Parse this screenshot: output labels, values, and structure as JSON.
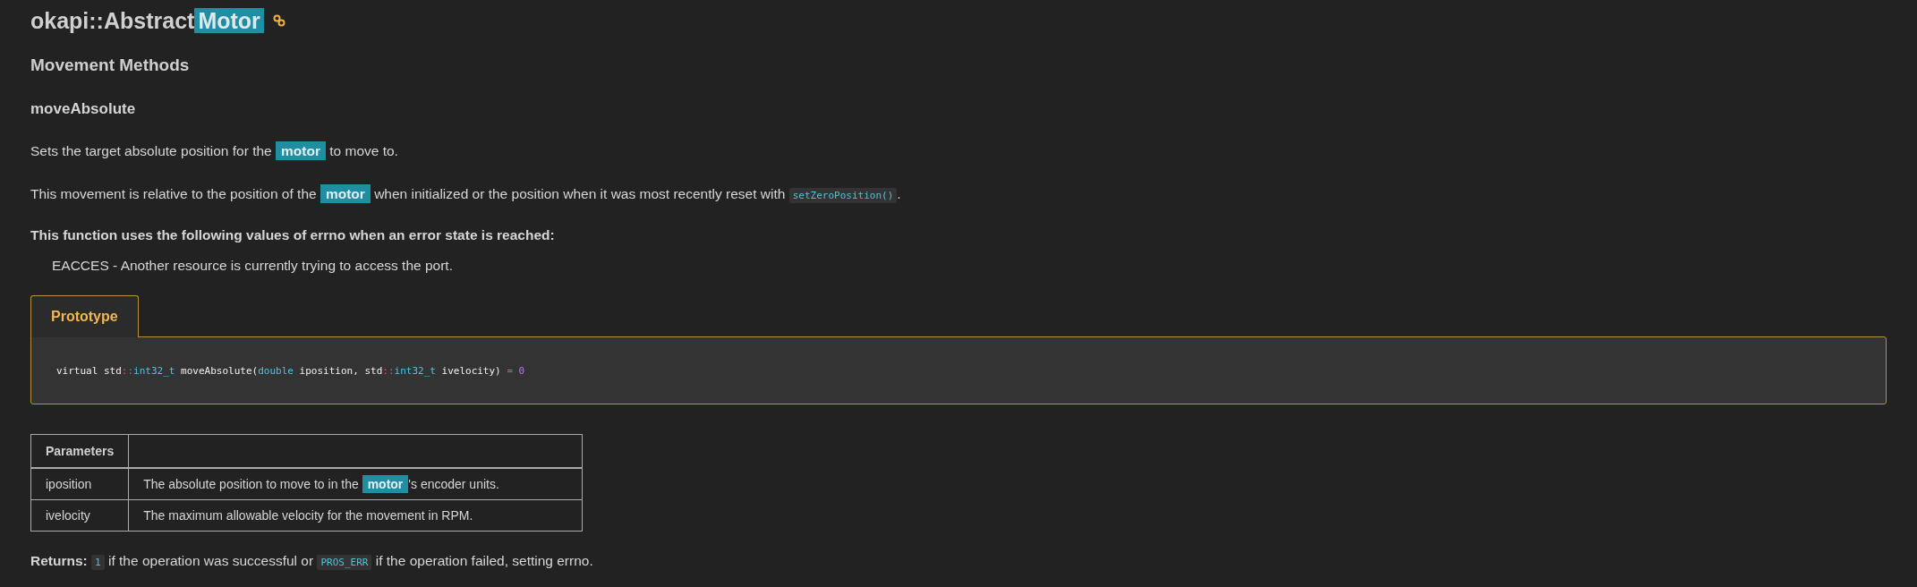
{
  "title": {
    "text": "okapi::Abstract",
    "highlight": "Motor"
  },
  "section_heading": "Movement Methods",
  "method_heading": "moveAbsolute",
  "paragraphs": [
    [
      {
        "kind": "text",
        "text": "Sets the target absolute position for the "
      },
      {
        "kind": "highlight",
        "text": "motor"
      },
      {
        "kind": "text",
        "text": " to move to."
      }
    ],
    [
      {
        "kind": "text",
        "text": "This movement is relative to the position of the "
      },
      {
        "kind": "highlight",
        "text": "motor"
      },
      {
        "kind": "text",
        "text": " when initialized or the position when it was most recently reset with "
      },
      {
        "kind": "code",
        "text": "setZeroPosition()"
      },
      {
        "kind": "text",
        "text": "."
      }
    ]
  ],
  "errno": {
    "heading": "This function uses the following values of errno when an error state is reached:",
    "items": [
      "EACCES - Another resource is currently trying to access the port."
    ]
  },
  "tabs": [
    {
      "label": "Prototype",
      "selected": true
    }
  ],
  "prototype": [
    {
      "kind": "plain",
      "text": "virtual std"
    },
    {
      "kind": "op",
      "text": "::"
    },
    {
      "kind": "type",
      "text": "int32_t"
    },
    {
      "kind": "plain",
      "text": " moveAbsolute("
    },
    {
      "kind": "type",
      "text": "double"
    },
    {
      "kind": "plain",
      "text": " iposition, std"
    },
    {
      "kind": "op",
      "text": "::"
    },
    {
      "kind": "type",
      "text": "int32_t"
    },
    {
      "kind": "plain",
      "text": " ivelocity) "
    },
    {
      "kind": "op",
      "text": "="
    },
    {
      "kind": "number",
      "text": " 0"
    }
  ],
  "parameters": {
    "header": "Parameters",
    "rows": [
      {
        "name": "iposition",
        "description": [
          {
            "kind": "text",
            "text": "The absolute position to move to in the "
          },
          {
            "kind": "highlight",
            "text": "motor"
          },
          {
            "kind": "text",
            "text": "'s encoder units."
          }
        ]
      },
      {
        "name": "ivelocity",
        "description": [
          {
            "kind": "text",
            "text": "The maximum allowable velocity for the movement in RPM."
          }
        ]
      }
    ]
  },
  "returns": {
    "label": "Returns:",
    "segments": [
      {
        "kind": "code",
        "text": "1"
      },
      {
        "kind": "text",
        "text": " if the operation was successful or "
      },
      {
        "kind": "code",
        "text": "PROS_ERR"
      },
      {
        "kind": "text",
        "text": " if the operation failed, setting errno."
      }
    ]
  }
}
